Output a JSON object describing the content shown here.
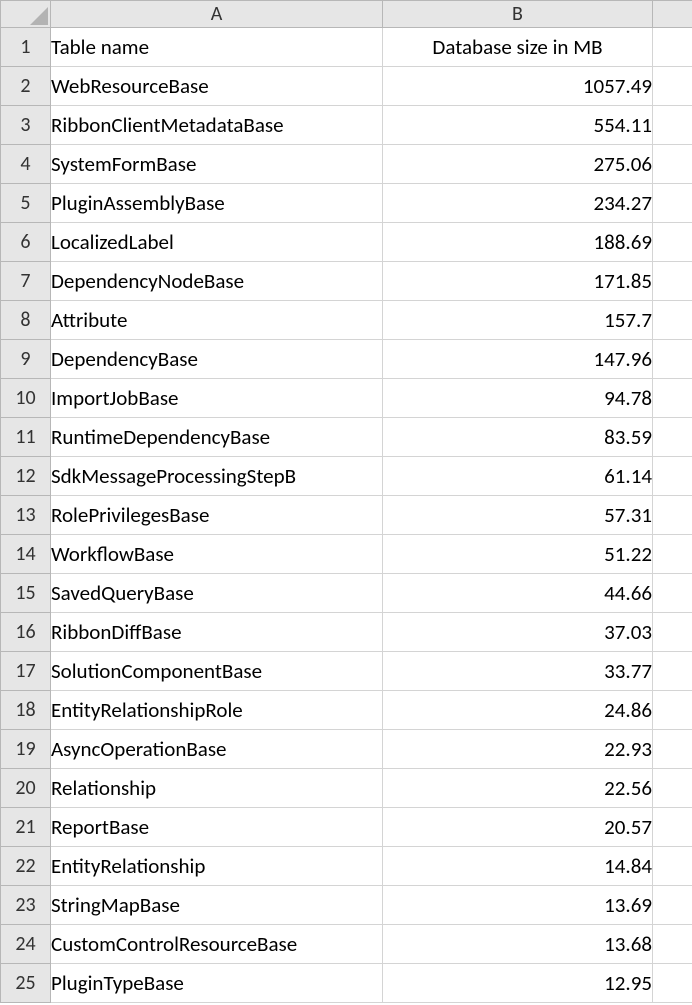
{
  "columns": {
    "A": "A",
    "B": "B"
  },
  "header_row": {
    "A": "Table name",
    "B": "Database size in MB"
  },
  "rows": [
    {
      "n": "1",
      "A": "Table name",
      "B": "Database size in MB"
    },
    {
      "n": "2",
      "A": "WebResourceBase",
      "B": "1057.49"
    },
    {
      "n": "3",
      "A": "RibbonClientMetadataBase",
      "B": "554.11"
    },
    {
      "n": "4",
      "A": "SystemFormBase",
      "B": "275.06"
    },
    {
      "n": "5",
      "A": "PluginAssemblyBase",
      "B": "234.27"
    },
    {
      "n": "6",
      "A": "LocalizedLabel",
      "B": "188.69"
    },
    {
      "n": "7",
      "A": "DependencyNodeBase",
      "B": "171.85"
    },
    {
      "n": "8",
      "A": "Attribute",
      "B": "157.7"
    },
    {
      "n": "9",
      "A": "DependencyBase",
      "B": "147.96"
    },
    {
      "n": "10",
      "A": "ImportJobBase",
      "B": "94.78"
    },
    {
      "n": "11",
      "A": "RuntimeDependencyBase",
      "B": "83.59"
    },
    {
      "n": "12",
      "A": "SdkMessageProcessingStepB",
      "B": "61.14"
    },
    {
      "n": "13",
      "A": "RolePrivilegesBase",
      "B": "57.31"
    },
    {
      "n": "14",
      "A": "WorkflowBase",
      "B": "51.22"
    },
    {
      "n": "15",
      "A": "SavedQueryBase",
      "B": "44.66"
    },
    {
      "n": "16",
      "A": "RibbonDiffBase",
      "B": "37.03"
    },
    {
      "n": "17",
      "A": "SolutionComponentBase",
      "B": "33.77"
    },
    {
      "n": "18",
      "A": "EntityRelationshipRole",
      "B": "24.86"
    },
    {
      "n": "19",
      "A": "AsyncOperationBase",
      "B": "22.93"
    },
    {
      "n": "20",
      "A": "Relationship",
      "B": "22.56"
    },
    {
      "n": "21",
      "A": "ReportBase",
      "B": "20.57"
    },
    {
      "n": "22",
      "A": "EntityRelationship",
      "B": "14.84"
    },
    {
      "n": "23",
      "A": "StringMapBase",
      "B": "13.69"
    },
    {
      "n": "24",
      "A": "CustomControlResourceBase",
      "B": "13.68"
    },
    {
      "n": "25",
      "A": "PluginTypeBase",
      "B": "12.95"
    }
  ],
  "chart_data": {
    "type": "table",
    "title": "",
    "columns": [
      "Table name",
      "Database size in MB"
    ],
    "rows": [
      [
        "WebResourceBase",
        1057.49
      ],
      [
        "RibbonClientMetadataBase",
        554.11
      ],
      [
        "SystemFormBase",
        275.06
      ],
      [
        "PluginAssemblyBase",
        234.27
      ],
      [
        "LocalizedLabel",
        188.69
      ],
      [
        "DependencyNodeBase",
        171.85
      ],
      [
        "Attribute",
        157.7
      ],
      [
        "DependencyBase",
        147.96
      ],
      [
        "ImportJobBase",
        94.78
      ],
      [
        "RuntimeDependencyBase",
        83.59
      ],
      [
        "SdkMessageProcessingStepB",
        61.14
      ],
      [
        "RolePrivilegesBase",
        57.31
      ],
      [
        "WorkflowBase",
        51.22
      ],
      [
        "SavedQueryBase",
        44.66
      ],
      [
        "RibbonDiffBase",
        37.03
      ],
      [
        "SolutionComponentBase",
        33.77
      ],
      [
        "EntityRelationshipRole",
        24.86
      ],
      [
        "AsyncOperationBase",
        22.93
      ],
      [
        "Relationship",
        22.56
      ],
      [
        "ReportBase",
        20.57
      ],
      [
        "EntityRelationship",
        14.84
      ],
      [
        "StringMapBase",
        13.69
      ],
      [
        "CustomControlResourceBase",
        13.68
      ],
      [
        "PluginTypeBase",
        12.95
      ]
    ]
  }
}
